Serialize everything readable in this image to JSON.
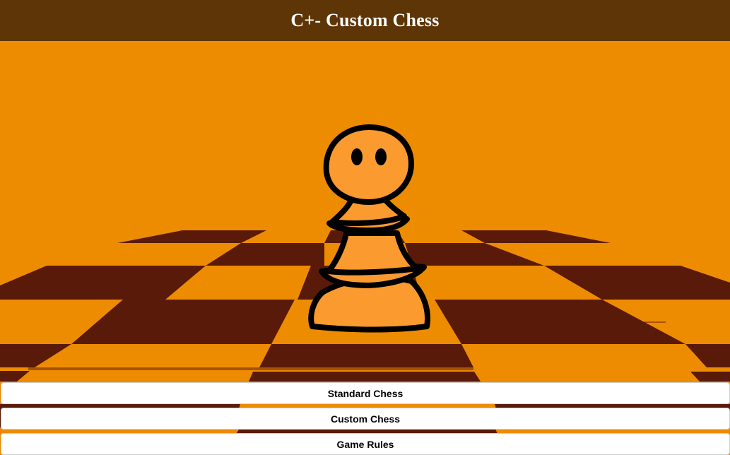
{
  "app": {
    "title": "C+- Custom Chess"
  },
  "menu": {
    "standard_label": "Standard Chess",
    "custom_label": "Custom Chess",
    "rules_label": "Game Rules"
  },
  "colors": {
    "header_bg": "#5e3507",
    "background": "#ee8c00",
    "board_dark": "#5a1a09",
    "board_light": "#ee8c00",
    "pawn_fill": "#fb9a2e",
    "pawn_outline": "#000000"
  },
  "hero": {
    "icon": "pawn-icon"
  }
}
